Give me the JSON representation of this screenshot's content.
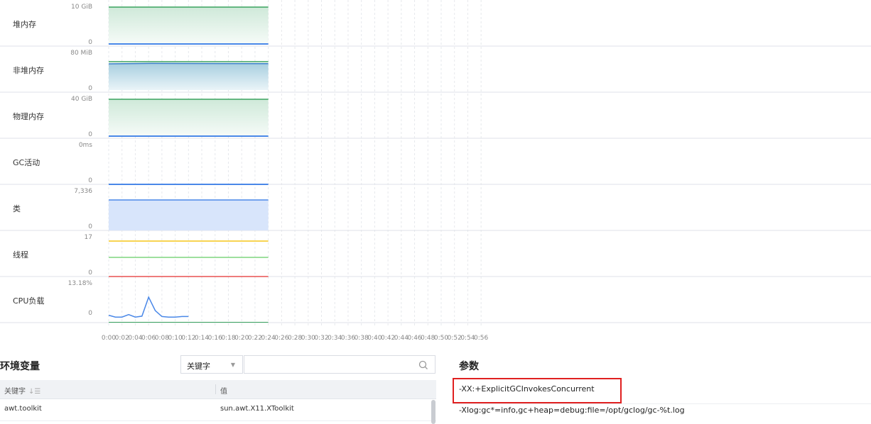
{
  "metrics": [
    {
      "label": "堆内存",
      "max": "10 GiB",
      "min": "0",
      "kind": "heap"
    },
    {
      "label": "非堆内存",
      "max": "80 MiB",
      "min": "0",
      "kind": "nonheap"
    },
    {
      "label": "物理内存",
      "max": "40 GiB",
      "min": "0",
      "kind": "physical"
    },
    {
      "label": "GC活动",
      "max": "0ms",
      "min": "0",
      "kind": "gc"
    },
    {
      "label": "类",
      "max": "7,336",
      "min": "0",
      "kind": "classes"
    },
    {
      "label": "线程",
      "max": "17",
      "min": "0",
      "kind": "threads"
    },
    {
      "label": "CPU负载",
      "max": "13.18%",
      "min": "0",
      "kind": "cpu"
    }
  ],
  "time_axis": [
    "0:00",
    "0:02",
    "0:04",
    "0:06",
    "0:08",
    "0:10",
    "0:12",
    "0:14",
    "0:16",
    "0:18",
    "0:20",
    "0:22",
    "0:24",
    "0:26",
    "0:28",
    "0:30",
    "0:32",
    "0:34",
    "0:36",
    "0:38",
    "0:40",
    "0:42",
    "0:44",
    "0:46",
    "0:48",
    "0:50",
    "0:52",
    "0:54",
    "0:56"
  ],
  "colors": {
    "green": "#3aa35f",
    "blue": "#4a88e8",
    "yellow": "#f5c518",
    "light_green": "#7fd67f",
    "red": "#e85050",
    "cpu": "#4a88e8"
  },
  "chart_data": {
    "type": "line",
    "x_unit": "minutes",
    "cpu_load_x": [
      0,
      1,
      2,
      3,
      4,
      5,
      6,
      7,
      8,
      9,
      10,
      11,
      12
    ],
    "cpu_load_percent": [
      1.0,
      0.4,
      0.4,
      1.2,
      0.4,
      0.7,
      6.8,
      2.5,
      0.6,
      0.4,
      0.4,
      0.6,
      0.6
    ],
    "cpu_load_ylim": [
      0,
      13.18
    ]
  },
  "env": {
    "title": "环境变量",
    "filter_select": "关键字",
    "search_placeholder": "",
    "col_key": "关键字",
    "col_val": "值",
    "rows": [
      {
        "key": "awt.toolkit",
        "value": "sun.awt.X11.XToolkit"
      }
    ]
  },
  "params": {
    "title": "参数",
    "items": [
      "-XX:+ExplicitGCInvokesConcurrent",
      "-Xlog:gc*=info,gc+heap=debug:file=/opt/gclog/gc-%t.log"
    ]
  }
}
